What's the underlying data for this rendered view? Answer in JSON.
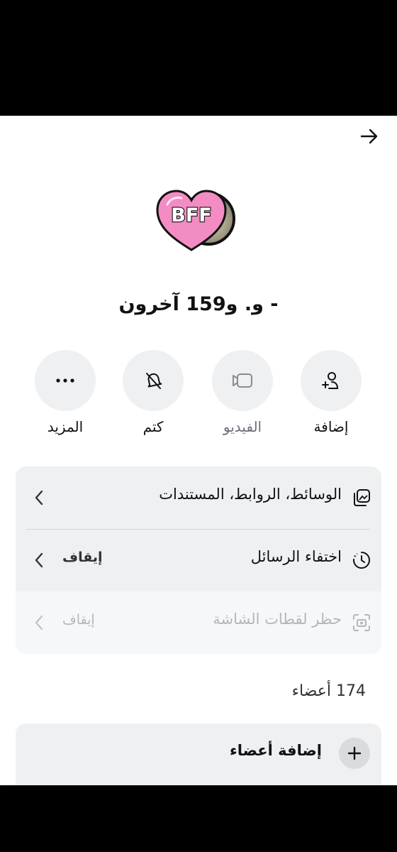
{
  "header": {
    "back_icon": "arrow-right-icon"
  },
  "group": {
    "title": "- و. و159 آخرون",
    "avatar_badge_text": "BFF"
  },
  "actions": [
    {
      "label": "إضافة",
      "icon": "add-person-icon"
    },
    {
      "label": "الفيديو",
      "icon": "video-camera-icon"
    },
    {
      "label": "كتم",
      "icon": "bell-off-icon"
    },
    {
      "label": "المزيد",
      "icon": "more-dots-icon"
    }
  ],
  "settings": {
    "media": {
      "label": "الوسائط، الروابط، المستندات",
      "icon": "media-gallery-icon"
    },
    "disappearing": {
      "label": "اختفاء الرسائل",
      "status": "إيقاف",
      "icon": "timer-icon"
    },
    "screenshot_block": {
      "label": "حظر لقطات الشاشة",
      "status": "إيقاف",
      "icon": "camera-screenshot-icon",
      "disabled": true
    }
  },
  "members": {
    "count_label": "174 أعضاء",
    "add_members_label": "إضافة أعضاء"
  }
}
